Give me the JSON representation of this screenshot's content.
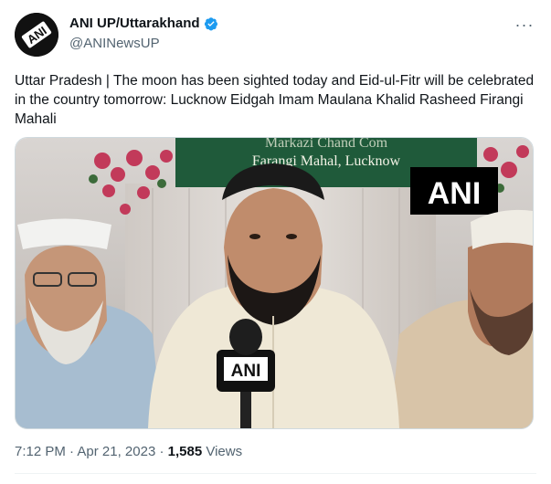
{
  "tweet": {
    "author": {
      "display_name": "ANI UP/Uttarakhand",
      "handle": "@ANINewsUP",
      "avatar_text": "ANI",
      "verified": true
    },
    "more_icon": "more-dots-icon",
    "text": "Uttar Pradesh | The moon has been sighted today and Eid-ul-Fitr will be celebrated in the country tomorrow: Lucknow Eidgah Imam Maulana Khalid Rasheed Firangi Mahali",
    "media": {
      "banner_top": "Markazi Chand Com",
      "banner_bottom": "Farangi Mahal, Lucknow",
      "watermark": "ANI",
      "mic_label": "ANI"
    },
    "time": "7:12 PM",
    "date": "Apr 21, 2023",
    "separator": "·",
    "views_count": "1,585",
    "views_label": "Views"
  },
  "colors": {
    "verified": "#1d9bf0",
    "text": "#0f1419",
    "secondary": "#536471",
    "banner_green": "#1f5a3a"
  }
}
